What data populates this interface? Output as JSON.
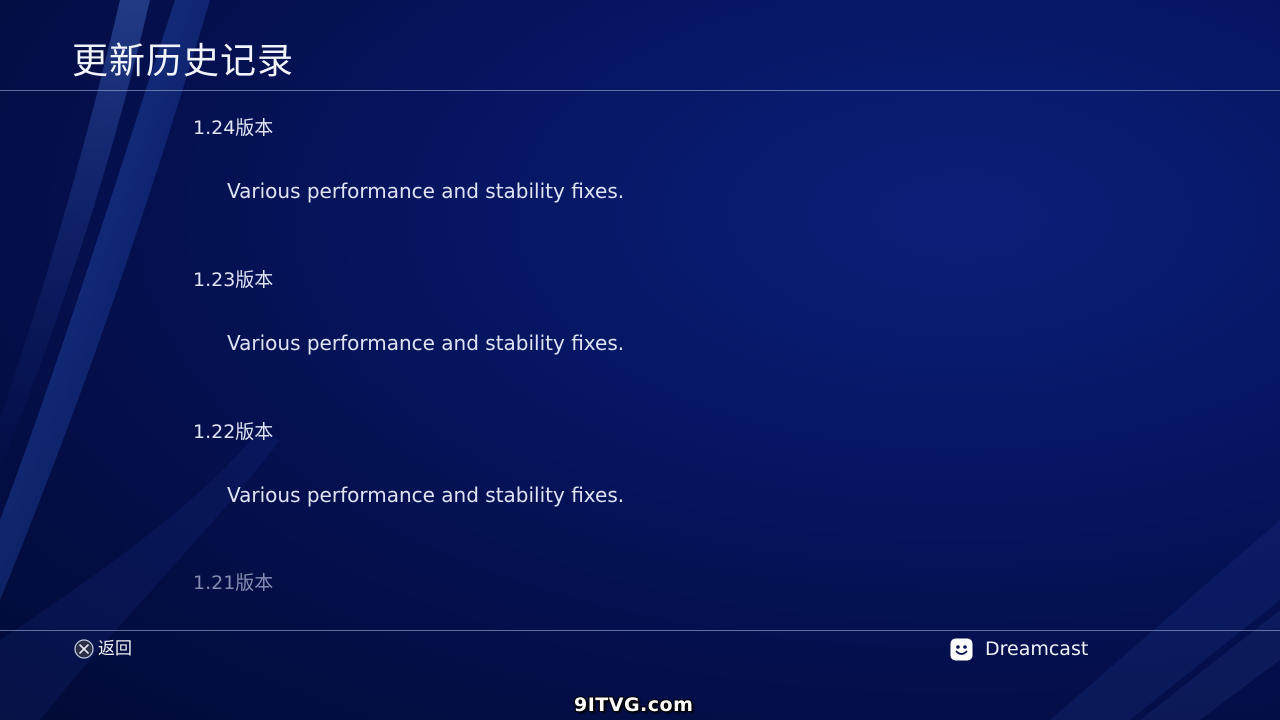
{
  "header": {
    "title": "更新历史记录"
  },
  "history": [
    {
      "version": "1.24版本",
      "notes": "Various performance and stability fixes."
    },
    {
      "version": "1.23版本",
      "notes": "Various performance and stability fixes."
    },
    {
      "version": "1.22版本",
      "notes": "Various performance and stability fixes."
    },
    {
      "version": "1.21版本",
      "notes": ""
    }
  ],
  "footer": {
    "back_label": "返回",
    "back_button_icon": "cross-button-icon",
    "user_icon": "smiley-avatar-icon",
    "username": "Dreamcast"
  },
  "watermark": "9ITVG.com",
  "colors": {
    "background": "#061663",
    "text": "#e8ecf8",
    "divider": "#aab9e1"
  }
}
